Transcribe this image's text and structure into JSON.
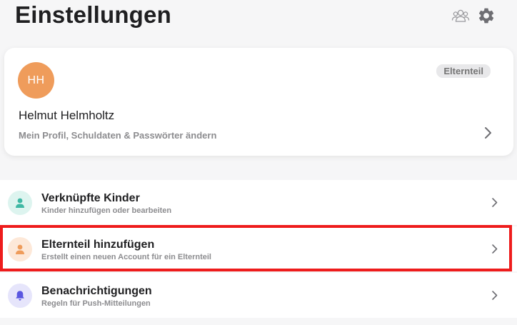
{
  "page": {
    "title": "Einstellungen"
  },
  "toolbar": {
    "icons": [
      "users-icon",
      "gear-icon"
    ]
  },
  "profile": {
    "initials": "HH",
    "role_badge": "Elternteil",
    "name": "Helmut Helmholtz",
    "subtitle": "Mein Profil, Schuldaten & Passwörter ändern",
    "avatar_color": "#ef9c5b"
  },
  "settings_list": [
    {
      "title": "Verknüpfte Kinder",
      "subtitle": "Kinder hinzufügen oder bearbeiten",
      "icon": "child-icon",
      "icon_color": "#3fb8a4",
      "icon_bg": "#ddf4ef"
    },
    {
      "title": "Elternteil hinzufügen",
      "subtitle": "Erstellt einen neuen Account für ein Elternteil",
      "icon": "parent-icon",
      "icon_color": "#ef9c5b",
      "icon_bg": "#fde8d8"
    },
    {
      "title": "Benachrichtigungen",
      "subtitle": "Regeln für Push-Mitteilungen",
      "icon": "bell-icon",
      "icon_color": "#5a57e0",
      "icon_bg": "#e6e5fb"
    }
  ],
  "highlight_color": "#ee1c1c"
}
